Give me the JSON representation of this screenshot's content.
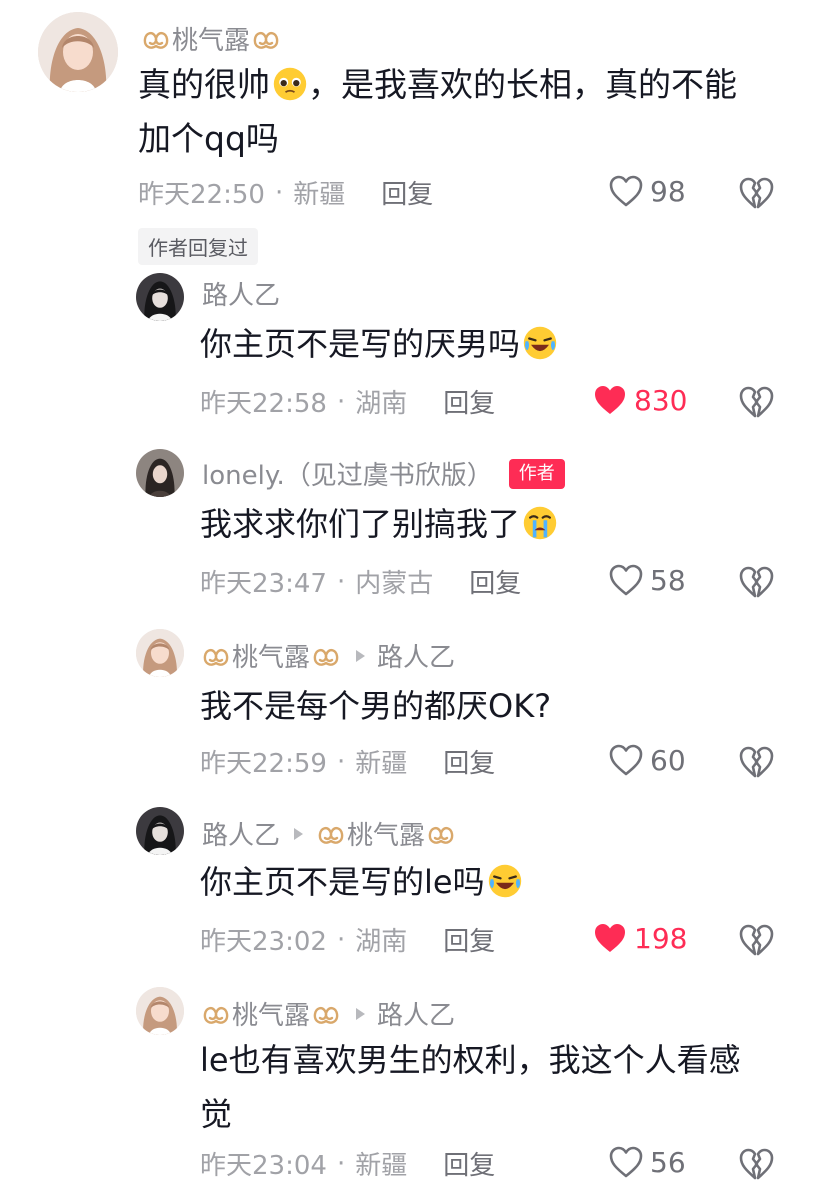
{
  "comments": [
    {
      "username": "桃气露",
      "text": "真的很帅",
      "text_after_emoji": "，是我喜欢的长相，真的不能",
      "text_line2": "加个qq吗",
      "time": "昨天22:50",
      "location": "新疆",
      "reply_label": "回复",
      "likes": "98",
      "liked": false,
      "author_replied_label": "作者回复过"
    }
  ],
  "replies": [
    {
      "username": "路人乙",
      "text": "你主页不是写的厌男吗",
      "time": "昨天22:58",
      "location": "湖南",
      "reply_label": "回复",
      "likes": "830",
      "liked": true
    },
    {
      "username": "lonely.（见过虞书欣版）",
      "author_tag": "作者",
      "text": "我求求你们了别搞我了",
      "time": "昨天23:47",
      "location": "内蒙古",
      "reply_label": "回复",
      "likes": "58",
      "liked": false
    },
    {
      "username": "桃气露",
      "reply_to": "路人乙",
      "text": "我不是每个男的都厌OK?",
      "time": "昨天22:59",
      "location": "新疆",
      "reply_label": "回复",
      "likes": "60",
      "liked": false
    },
    {
      "username": "路人乙",
      "reply_to": "桃气露",
      "text": "你主页不是写的le吗",
      "time": "昨天23:02",
      "location": "湖南",
      "reply_label": "回复",
      "likes": "198",
      "liked": true
    },
    {
      "username": "桃气露",
      "reply_to": "路人乙",
      "text": "le也有喜欢男生的权利，我这个人看感",
      "text_line2": "觉",
      "time": "昨天23:04",
      "location": "新疆",
      "reply_label": "回复",
      "likes": "56",
      "liked": false
    }
  ],
  "separator": "·",
  "colors": {
    "accent": "#fe2c55",
    "muted": "#a1a2a7",
    "text": "#161823"
  }
}
